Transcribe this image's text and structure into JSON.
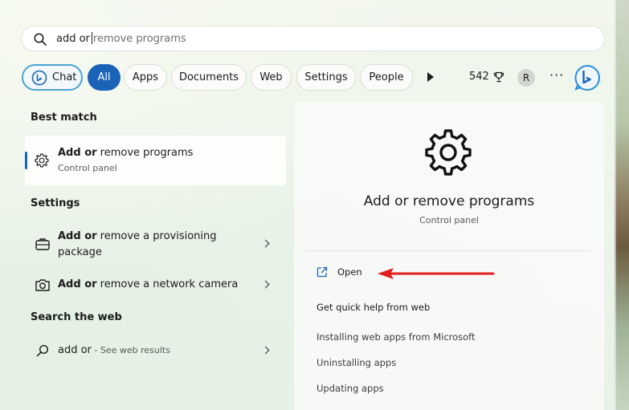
{
  "search": {
    "typed": "add or",
    "suggestion": "remove programs"
  },
  "filters": {
    "chat": "Chat",
    "all": "All",
    "apps": "Apps",
    "documents": "Documents",
    "web": "Web",
    "settings": "Settings",
    "people": "People",
    "points": "542",
    "avatar_initial": "R",
    "more": "···"
  },
  "left": {
    "best_match_heading": "Best match",
    "best_match": {
      "title_bold": "Add or",
      "title_rest": " remove programs",
      "subtitle": "Control panel"
    },
    "settings_heading": "Settings",
    "settings_items": [
      {
        "bold": "Add or",
        "rest": " remove a provisioning",
        "line2": "package"
      },
      {
        "bold": "Add or",
        "rest": " remove a network camera"
      }
    ],
    "web_heading": "Search the web",
    "web_item": {
      "query": "add or",
      "hint": " - See web results"
    }
  },
  "right": {
    "title": "Add or remove programs",
    "subtitle": "Control panel",
    "open_label": "Open",
    "quick_help": "Get quick help from web",
    "links": [
      "Installing web apps from Microsoft",
      "Uninstalling apps",
      "Updating apps"
    ]
  },
  "colors": {
    "accent": "#1a63b7",
    "annotation_arrow": "#e01f1f"
  }
}
